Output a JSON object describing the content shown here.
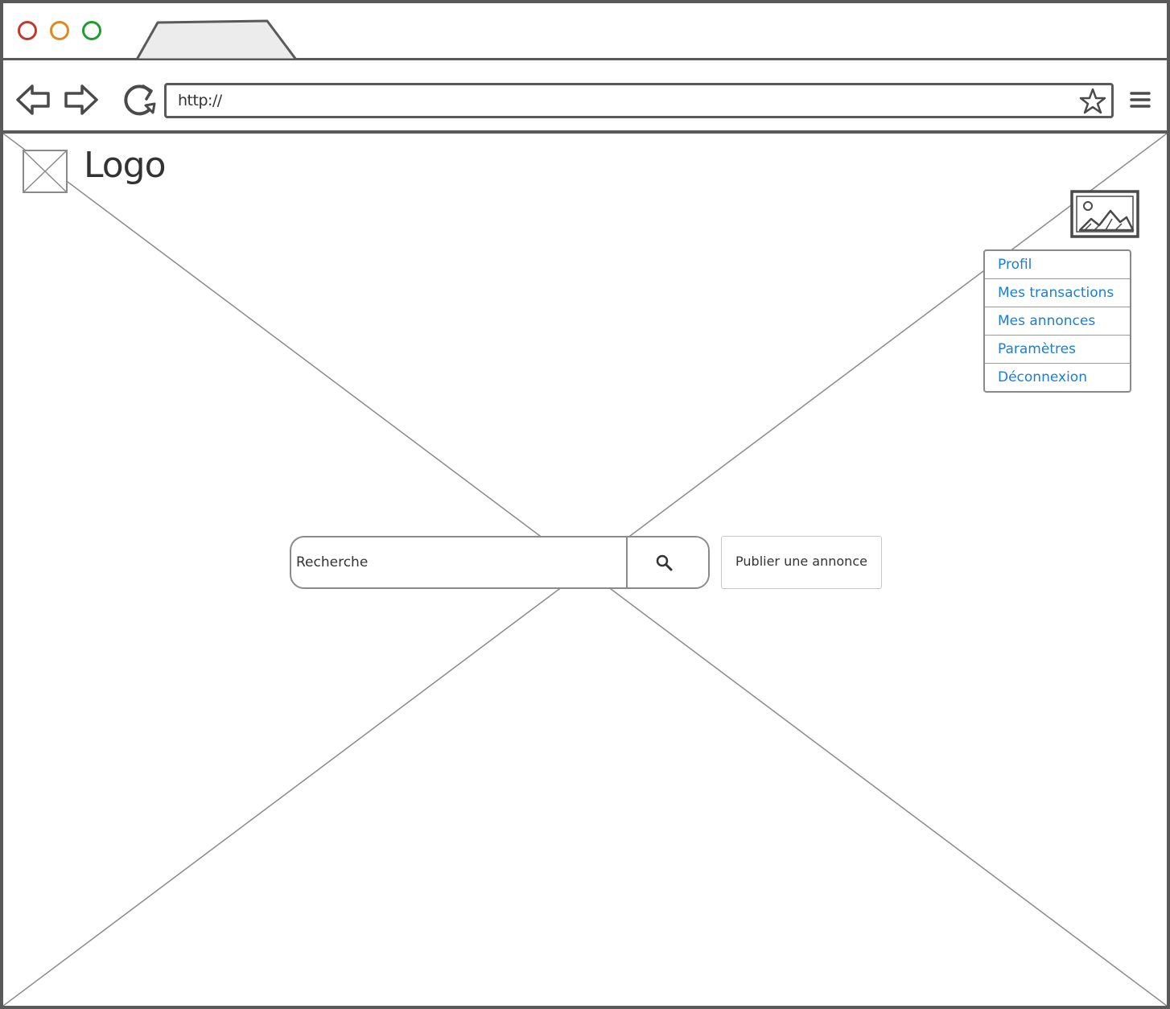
{
  "browser": {
    "window_controls": [
      {
        "name": "close",
        "color": "#c0392b"
      },
      {
        "name": "minimize",
        "color": "#e08a1e"
      },
      {
        "name": "maximize",
        "color": "#1e9e2e"
      }
    ],
    "address": "http://",
    "icons": {
      "back": "back-arrow-icon",
      "forward": "forward-arrow-icon",
      "reload": "reload-icon",
      "bookmark": "star-icon",
      "menu": "hamburger-menu-icon"
    }
  },
  "header": {
    "logo_text": "Logo",
    "logo_icon": "image-placeholder-icon",
    "avatar_icon": "image-icon"
  },
  "user_menu": {
    "items": [
      {
        "label": "Profil"
      },
      {
        "label": "Mes transactions"
      },
      {
        "label": "Mes annonces"
      },
      {
        "label": "Paramètres"
      },
      {
        "label": "Déconnexion"
      }
    ],
    "link_color": "#1a7fd4"
  },
  "search": {
    "placeholder": "Recherche",
    "icon": "search-icon"
  },
  "actions": {
    "publish_label": "Publier une annonce"
  }
}
